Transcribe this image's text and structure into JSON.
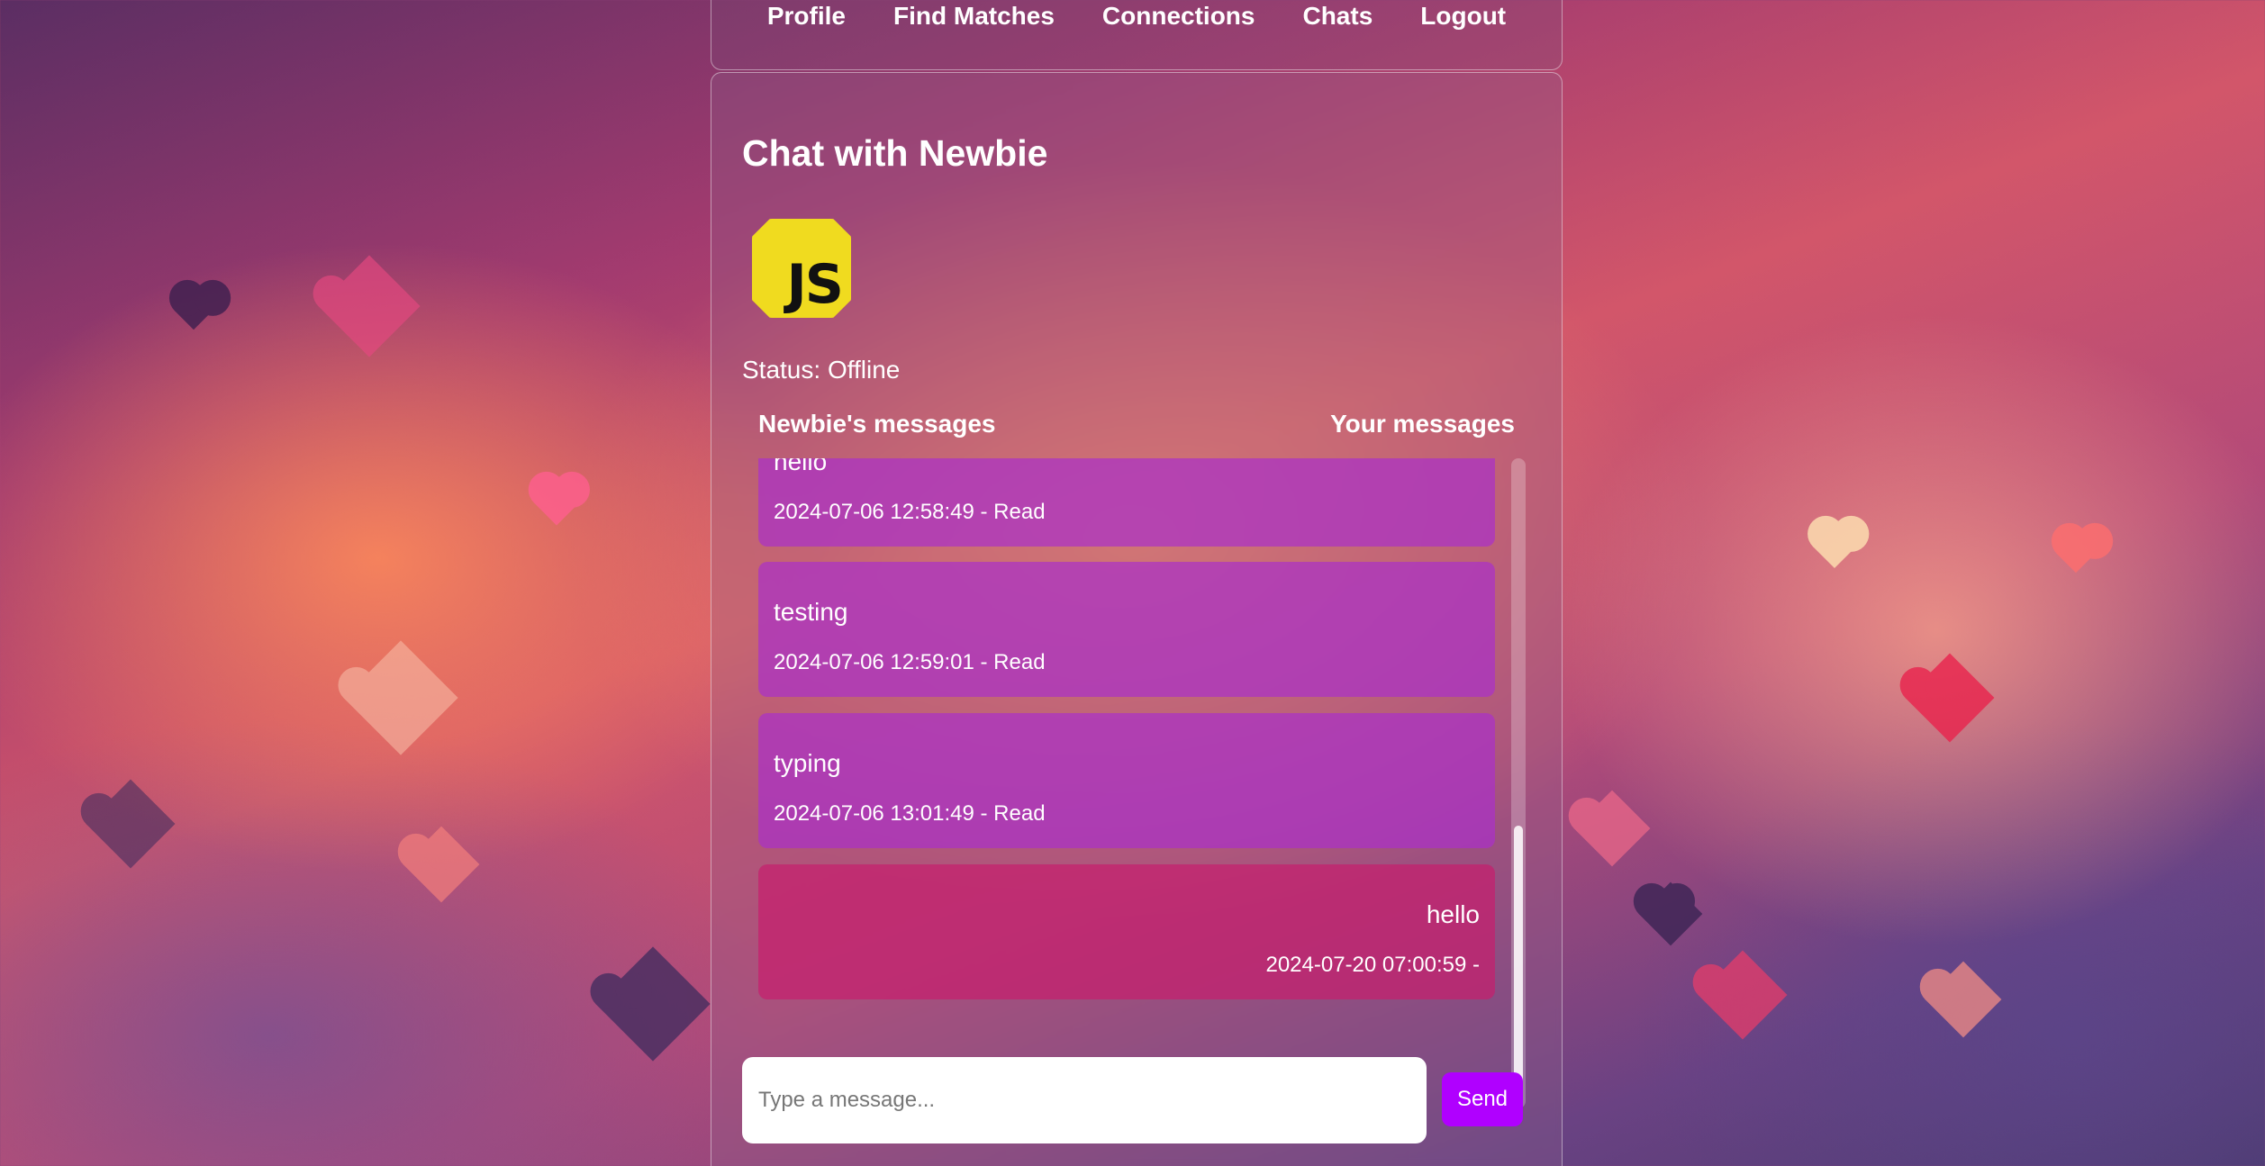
{
  "nav": {
    "links": [
      {
        "label": "Profile"
      },
      {
        "label": "Find Matches"
      },
      {
        "label": "Connections"
      },
      {
        "label": "Chats"
      },
      {
        "label": "Logout"
      }
    ]
  },
  "chat": {
    "title": "Chat with Newbie",
    "avatar_text": "JS",
    "status": "Status: Offline",
    "left_header": "Newbie's messages",
    "right_header": "Your messages",
    "messages": [
      {
        "sender": "other",
        "text": "hello",
        "meta": "2024-07-06 12:58:49 - Read"
      },
      {
        "sender": "other",
        "text": "testing",
        "meta": "2024-07-06 12:59:01 - Read"
      },
      {
        "sender": "other",
        "text": "typing",
        "meta": "2024-07-06 13:01:49 - Read"
      },
      {
        "sender": "me",
        "text": "hello",
        "meta": "2024-07-20 07:00:59 -"
      }
    ],
    "input_placeholder": "Type a message...",
    "send_label": "Send"
  },
  "colors": {
    "other_bubble": "#aa32c8",
    "my_bubble": "#c81e6e",
    "send_button": "#b000ff",
    "avatar_bg": "#f0db1f"
  },
  "icons": {
    "avatar": "javascript-logo-icon"
  }
}
